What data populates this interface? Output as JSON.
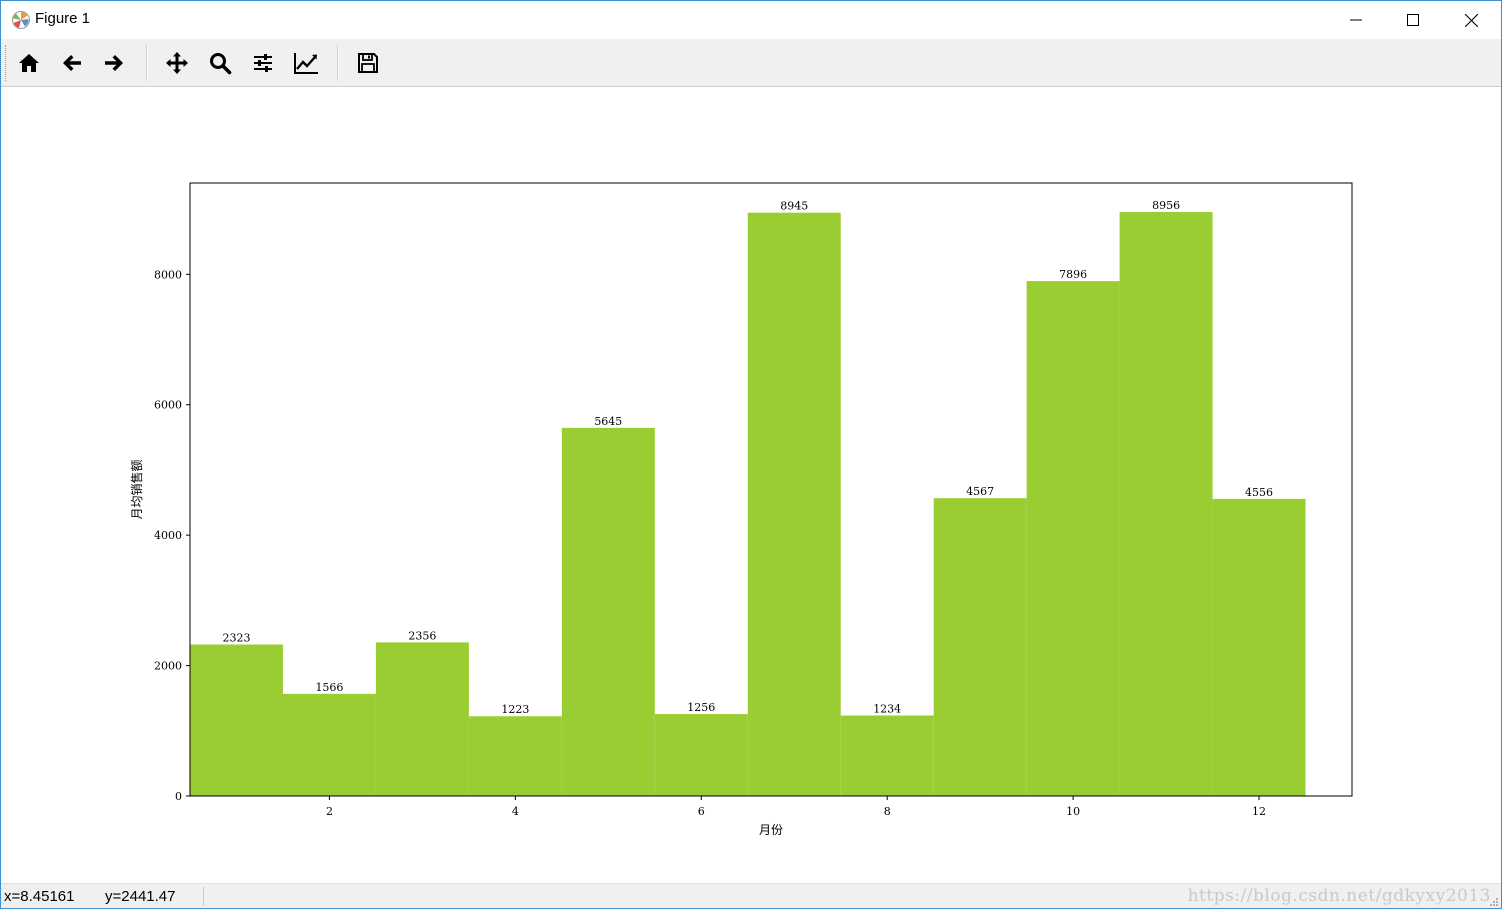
{
  "window": {
    "title": "Figure 1"
  },
  "toolbar": {
    "buttons": [
      {
        "name": "home",
        "icon": "home-icon"
      },
      {
        "name": "back",
        "icon": "arrow-left-icon"
      },
      {
        "name": "forward",
        "icon": "arrow-right-icon"
      },
      {
        "name": "pan",
        "icon": "move-icon"
      },
      {
        "name": "zoom",
        "icon": "magnifier-icon"
      },
      {
        "name": "subplots",
        "icon": "sliders-icon"
      },
      {
        "name": "customize",
        "icon": "line-chart-icon"
      },
      {
        "name": "save",
        "icon": "floppy-disk-icon"
      }
    ]
  },
  "status": {
    "x": "x=8.45161",
    "y": "y=2441.47",
    "watermark": "https://blog.csdn.net/gdkyxy2013"
  },
  "colors": {
    "bar": "#9acd32",
    "window_border": "#3c8fd4",
    "toolbar_bg": "#f0f0f0"
  },
  "chart_data": {
    "type": "bar",
    "x": [
      1,
      2,
      3,
      4,
      5,
      6,
      7,
      8,
      9,
      10,
      11,
      12
    ],
    "values": [
      2323,
      1566,
      2356,
      1223,
      5645,
      1256,
      8945,
      1234,
      4567,
      7896,
      8956,
      4556
    ],
    "data_labels": [
      "2323",
      "1566",
      "2356",
      "1223",
      "5645",
      "1256",
      "8945",
      "1234",
      "4567",
      "7896",
      "8956",
      "4556"
    ],
    "bar_width": 1.0,
    "xlabel": "月份",
    "ylabel": "月均销售额",
    "xlim": [
      0.5,
      13.0
    ],
    "ylim": [
      0,
      9400
    ],
    "xticks": [
      2,
      4,
      6,
      8,
      10,
      12
    ],
    "xtick_labels": [
      "2",
      "4",
      "6",
      "8",
      "10",
      "12"
    ],
    "yticks": [
      0,
      2000,
      4000,
      6000,
      8000
    ],
    "ytick_labels": [
      "0",
      "2000",
      "4000",
      "6000",
      "8000"
    ],
    "grid": false,
    "color": "#9acd32"
  }
}
